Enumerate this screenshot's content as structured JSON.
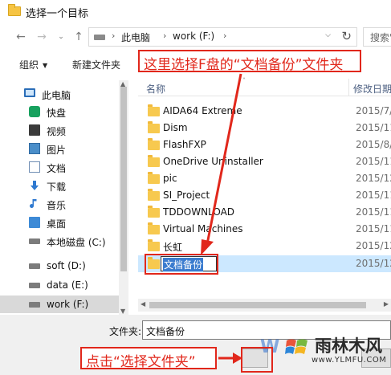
{
  "window": {
    "title": "选择一个目标"
  },
  "address_bar": {
    "crumbs": [
      "此电脑",
      "work (F:)"
    ],
    "search_placeholder": "搜索\"work (F:)\""
  },
  "toolbar": {
    "organize": "组织",
    "new_folder": "新建文件夹"
  },
  "sidebar": {
    "items": [
      {
        "label": "此电脑",
        "icon": "computer-icon"
      },
      {
        "label": "快盘",
        "icon": "cloud-drive-icon"
      },
      {
        "label": "视频",
        "icon": "video-icon"
      },
      {
        "label": "图片",
        "icon": "pictures-icon"
      },
      {
        "label": "文档",
        "icon": "documents-icon"
      },
      {
        "label": "下载",
        "icon": "download-icon"
      },
      {
        "label": "音乐",
        "icon": "music-icon"
      },
      {
        "label": "桌面",
        "icon": "desktop-icon"
      },
      {
        "label": "本地磁盘 (C:)",
        "icon": "drive-icon"
      },
      {
        "label": "soft (D:)",
        "icon": "drive-icon"
      },
      {
        "label": "data (E:)",
        "icon": "drive-icon"
      },
      {
        "label": "work (F:)",
        "icon": "drive-icon",
        "selected": true
      }
    ]
  },
  "file_list": {
    "columns": {
      "name": "名称",
      "date": "修改日期"
    },
    "rows": [
      {
        "name": "AIDA64 Extreme",
        "date": "2015/7/"
      },
      {
        "name": "Dism",
        "date": "2015/11"
      },
      {
        "name": "FlashFXP",
        "date": "2015/8/"
      },
      {
        "name": "OneDrive Uninstaller",
        "date": "2015/11"
      },
      {
        "name": "pic",
        "date": "2015/12"
      },
      {
        "name": "SI_Project",
        "date": "2015/11"
      },
      {
        "name": "TDDOWNLOAD",
        "date": "2015/11"
      },
      {
        "name": "Virtual Machines",
        "date": "2015/11"
      },
      {
        "name": "长虹",
        "date": "2015/12"
      },
      {
        "name": "文档备份",
        "date": "2015/12",
        "selected": true,
        "renaming": true
      }
    ]
  },
  "folder_field": {
    "label": "文件夹:",
    "value": "文档备份"
  },
  "annotations": {
    "top": "这里选择F盘的“文档备份”文件夹",
    "bottom": "点击“选择文件夹”"
  },
  "watermark": {
    "text": "雨林木风",
    "url": "www.YLMFU.COM"
  },
  "colors": {
    "annotation": "#e1271b",
    "selection": "#cce8ff"
  }
}
